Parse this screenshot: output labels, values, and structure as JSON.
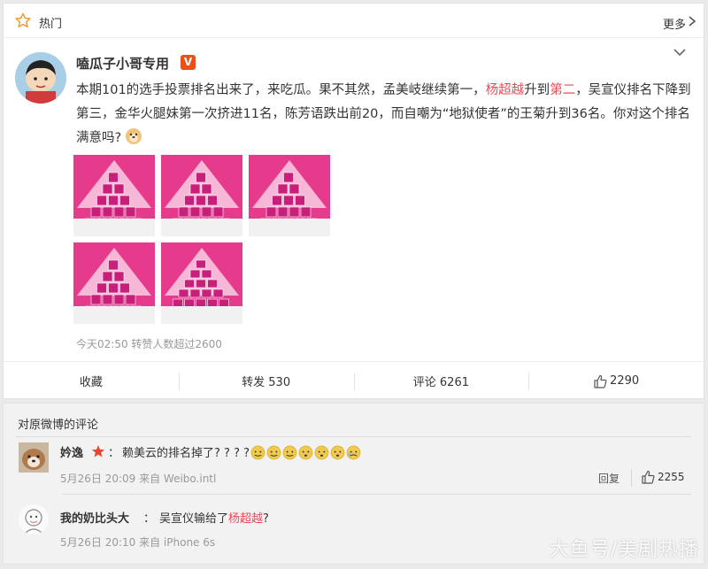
{
  "header": {
    "hot_label": "热门",
    "more_label": "更多"
  },
  "post": {
    "username": "嗑瓜子小哥专用",
    "vip_badge": "V",
    "text_parts": [
      "本期101的选手投票排名出来了，来吃瓜。果不其然，孟美岐继续第一，",
      "杨超越",
      "升到",
      "第二",
      "，吴宣仪排名下降到第三，金华火腿妹第一次挤进11名，陈芳语跌出前20，而自嘲为“地狱使者”的王菊升到36名。你对这个排名满意吗?"
    ],
    "emoji_name": "doge-emoji",
    "image_count": 5,
    "meta": "今天02:50 转赞人数超过2600"
  },
  "actions": {
    "favorite": "收藏",
    "forward": "转发 530",
    "comment": "评论 6261",
    "like": "2290"
  },
  "comments_section": {
    "title": "对原微博的评论",
    "items": [
      {
        "name": "妗逸",
        "separator": "：",
        "text": "赖美云的排名掉了? ? ? ?",
        "time": "5月26日 20:09 来自 Weibo.intl",
        "reply_label": "回复",
        "likes": "2255"
      },
      {
        "name": "我的奶比头大",
        "separator": "：",
        "text_prefix": "吴宣仪输给了",
        "text_highlight": "杨超越",
        "text_suffix": "?",
        "time": "5月26日 20:10 来自 iPhone 6s"
      }
    ]
  },
  "watermark": "大鱼号/美剧热播",
  "colors": {
    "highlight": "#eb4a58",
    "thumb_pink": "#e63a8c",
    "badge_orange": "#e8501c"
  }
}
